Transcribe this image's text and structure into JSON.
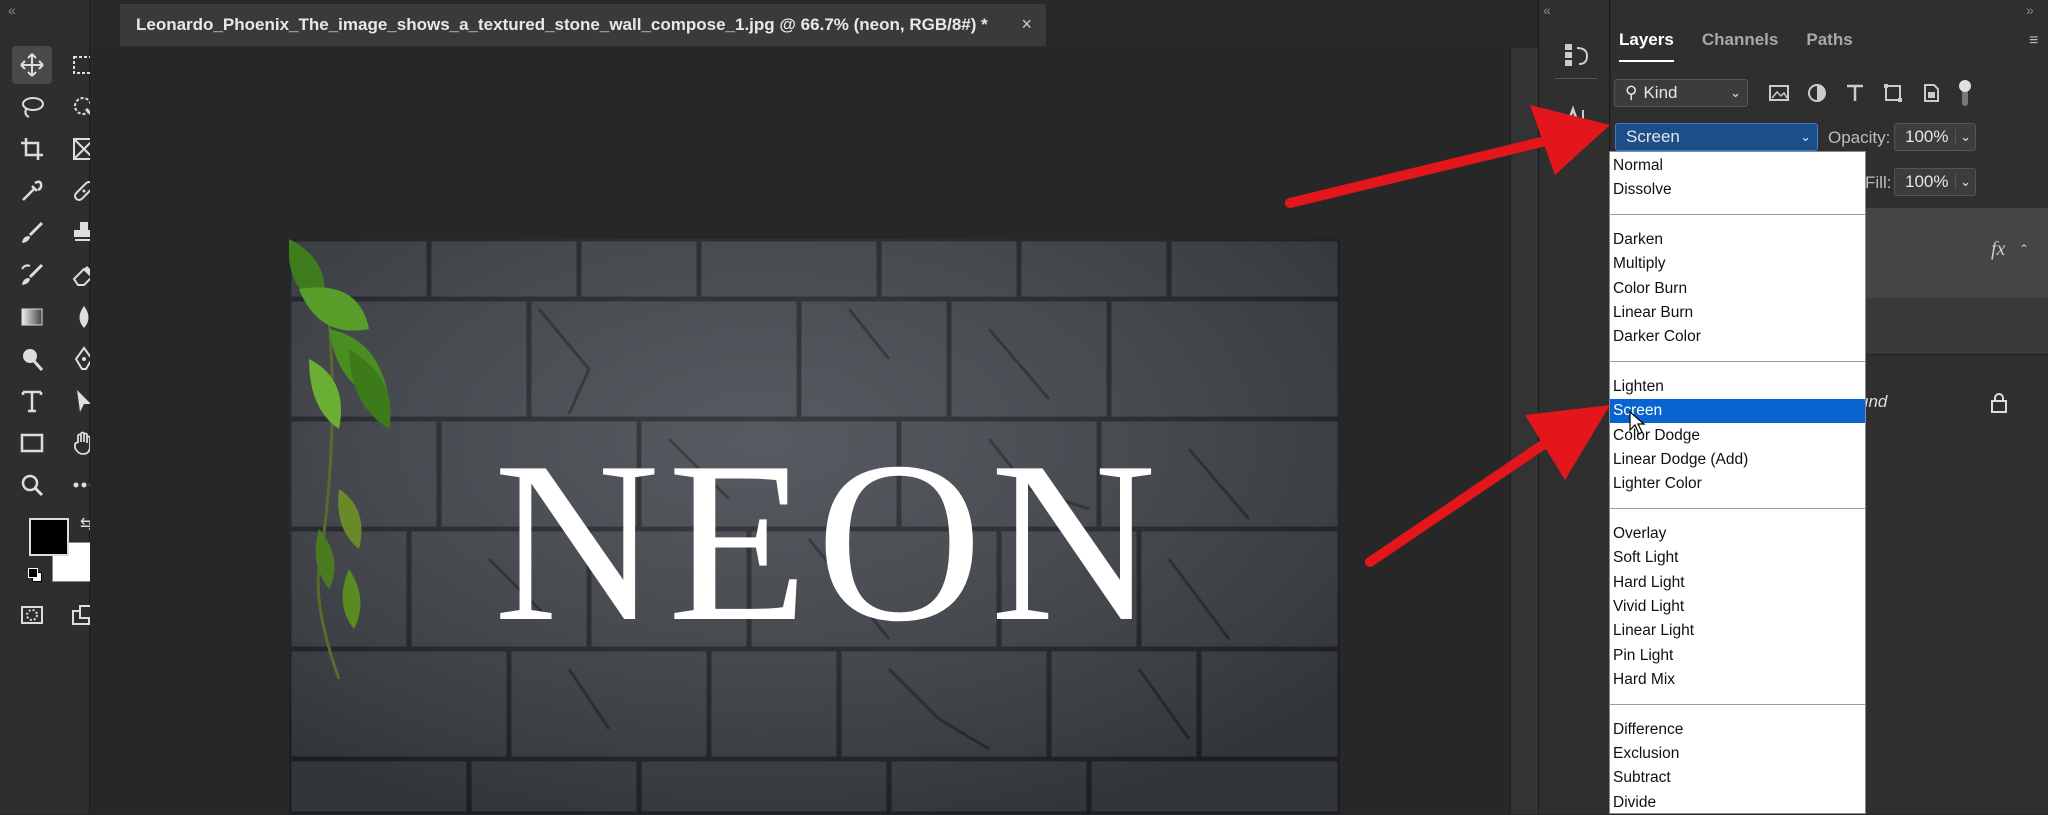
{
  "document": {
    "tab_title": "Leonardo_Phoenix_The_image_shows_a_textured_stone_wall_compose_1.jpg @ 66.7% (neon, RGB/8#) *",
    "close_glyph": "×",
    "neon_text": "NEON"
  },
  "layers_panel": {
    "tabs": [
      "Layers",
      "Channels",
      "Paths"
    ],
    "filter_kind": "Kind",
    "blend_mode": "Screen",
    "opacity_label": "Opacity:",
    "opacity_value": "100%",
    "fill_label": "Fill:",
    "fill_value": "100%",
    "fx_label": "fx",
    "background_layer_partial": "und"
  },
  "blend_menu": {
    "groups": [
      [
        "Normal",
        "Dissolve"
      ],
      [
        "Darken",
        "Multiply",
        "Color Burn",
        "Linear Burn",
        "Darker Color"
      ],
      [
        "Lighten",
        "Screen",
        "Color Dodge",
        "Linear Dodge (Add)",
        "Lighter Color"
      ],
      [
        "Overlay",
        "Soft Light",
        "Hard Light",
        "Vivid Light",
        "Linear Light",
        "Pin Light",
        "Hard Mix"
      ],
      [
        "Difference",
        "Exclusion",
        "Subtract",
        "Divide"
      ]
    ],
    "selected": "Screen"
  },
  "colors": {
    "arrow": "#e3161b",
    "selection": "#0a64cf",
    "foreground": "#000000",
    "background": "#ffffff"
  }
}
